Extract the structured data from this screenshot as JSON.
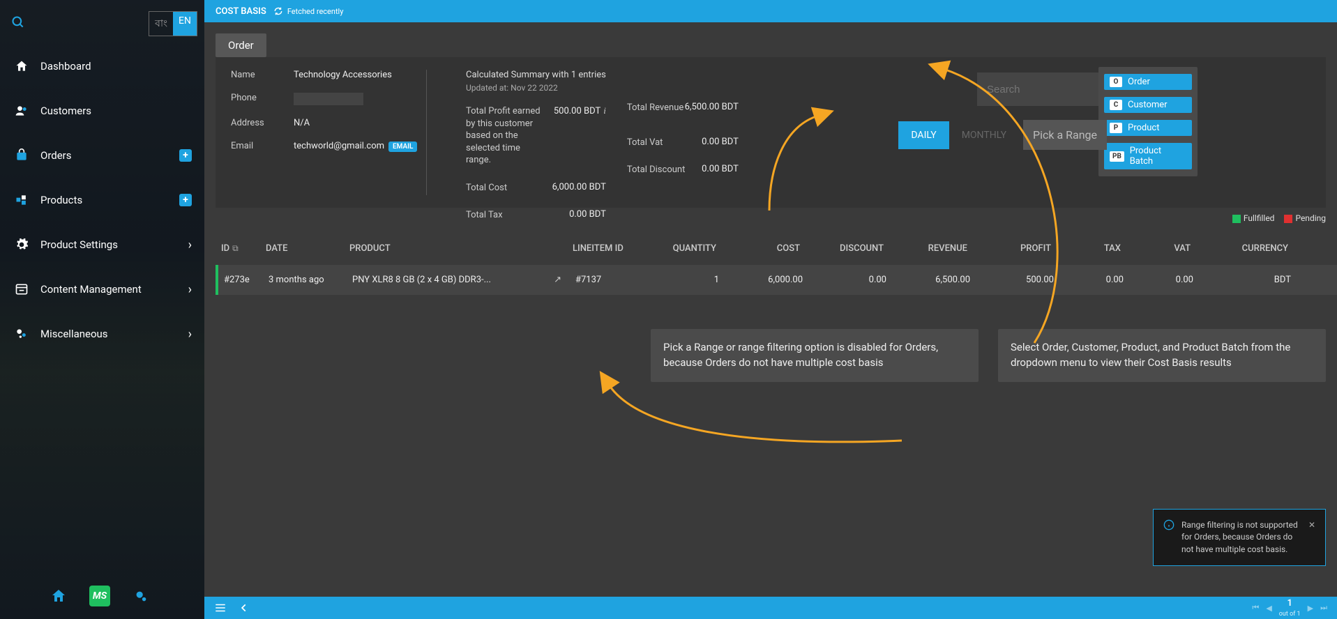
{
  "sidebar": {
    "lang_bn": "বাং",
    "lang_en": "EN",
    "items": [
      {
        "label": "Dashboard"
      },
      {
        "label": "Customers"
      },
      {
        "label": "Orders"
      },
      {
        "label": "Products"
      },
      {
        "label": "Product Settings"
      },
      {
        "label": "Content Management"
      },
      {
        "label": "Miscellaneous"
      }
    ],
    "footer_ms": "MS"
  },
  "topbar": {
    "title": "COST BASIS",
    "fetched": "Fetched recently"
  },
  "pill": "Order",
  "customer": {
    "name_label": "Name",
    "name": "Technology Accessories",
    "phone_label": "Phone",
    "address_label": "Address",
    "address": "N/A",
    "email_label": "Email",
    "email": "techworld@gmail.com",
    "email_badge": "EMAIL"
  },
  "summary": {
    "head": "Calculated Summary with 1 entries",
    "updated": "Updated at: Nov 22 2022",
    "profit_label": "Total Profit earned by this customer based on the selected time range.",
    "profit": "500.00 BDT",
    "cost_label": "Total Cost",
    "cost": "6,000.00 BDT",
    "tax_label": "Total Tax",
    "tax": "0.00 BDT",
    "revenue_label": "Total Revenue",
    "revenue": "6,500.00 BDT",
    "vat_label": "Total Vat",
    "vat": "0.00 BDT",
    "discount_label": "Total Discount",
    "discount": "0.00 BDT"
  },
  "search": {
    "placeholder": "Search"
  },
  "dropdown": {
    "items": [
      {
        "badge": "O",
        "label": "Order"
      },
      {
        "badge": "C",
        "label": "Customer"
      },
      {
        "badge": "P",
        "label": "Product"
      },
      {
        "badge": "PB",
        "label": "Product Batch"
      }
    ]
  },
  "range": {
    "daily": "DAILY",
    "monthly": "MONTHLY",
    "pick": "Pick a Range"
  },
  "legend": {
    "fulfilled": "Fullfilled",
    "pending": "Pending"
  },
  "table": {
    "headers": {
      "id": "ID",
      "date": "DATE",
      "product": "PRODUCT",
      "lineitem": "LINEITEM ID",
      "qty": "QUANTITY",
      "cost": "COST",
      "discount": "DISCOUNT",
      "revenue": "REVENUE",
      "profit": "PROFIT",
      "tax": "TAX",
      "vat": "VAT",
      "currency": "CURRENCY"
    },
    "rows": [
      {
        "id": "#273e",
        "date": "3 months ago",
        "product": "PNY XLR8 8 GB (2 x 4 GB) DDR3-...",
        "lineitem": "#7137",
        "qty": "1",
        "cost": "6,000.00",
        "discount": "0.00",
        "revenue": "6,500.00",
        "profit": "500.00",
        "tax": "0.00",
        "vat": "0.00",
        "currency": "BDT"
      }
    ]
  },
  "callout1": "Pick a Range or range filtering option is disabled for Orders, because Orders do not have multiple cost basis",
  "callout2": "Select Order, Customer, Product, and Product Batch from the dropdown menu to view their Cost Basis results",
  "toast": "Range filtering is not supported for Orders, because Orders do not have multiple cost basis.",
  "pager": {
    "page": "1",
    "total": "out of 1"
  },
  "colors": {
    "accent": "#1fa3e0",
    "arrow": "#f5a623"
  }
}
